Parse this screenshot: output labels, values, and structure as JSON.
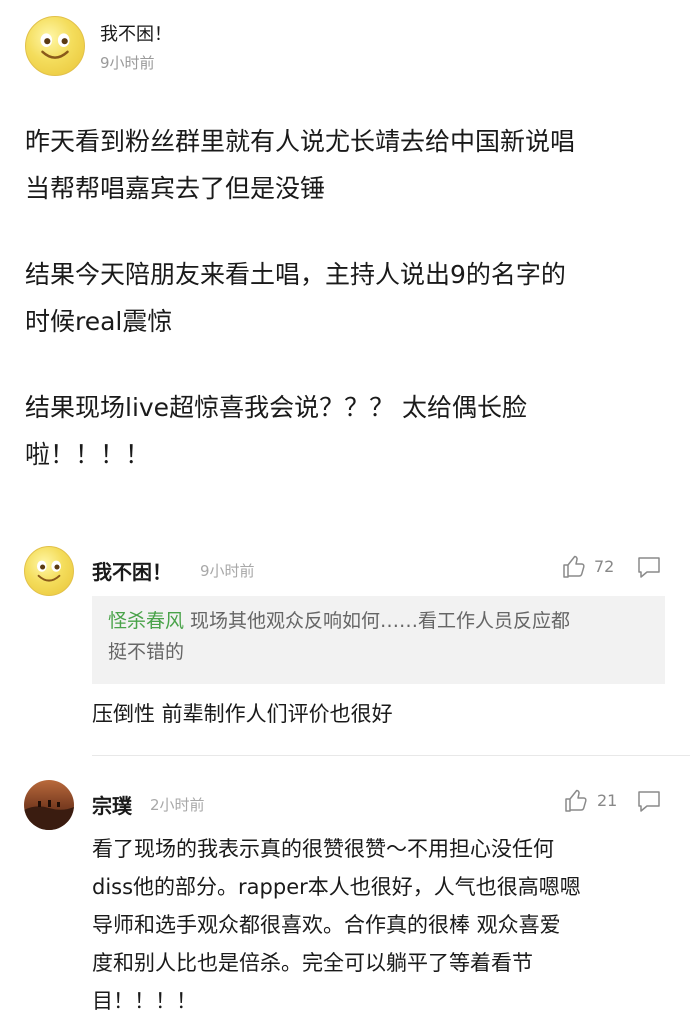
{
  "post": {
    "author": "我不困！",
    "time": "9小时前",
    "paragraphs": [
      [
        "昨天看到粉丝群里就有人说尤长靖去给中国新说唱",
        "当帮帮唱嘉宾去了但是没锤"
      ],
      [
        "结果今天陪朋友来看土唱，主持人说出9的名字的",
        "时候real震惊"
      ],
      [
        "结果现场live超惊喜我会说？？？ 太给偶长脸",
        "啦！！！！"
      ]
    ]
  },
  "comments": [
    {
      "author": "我不困！",
      "time": "9小时前",
      "likes": "72",
      "quote_name": "怪杀春风",
      "quote_text_line1": " 现场其他观众反响如何……看工作人员反应都",
      "quote_text_line2": "挺不错的",
      "text": "压倒性 前辈制作人们评价也很好"
    },
    {
      "author": "宗璞",
      "time": "2小时前",
      "likes": "21",
      "lines": [
        "看了现场的我表示真的很赞很赞～不用担心没任何",
        "diss他的部分。rapper本人也很好，人气也很高嗯嗯",
        "导师和选手观众都很喜欢。合作真的很棒 观众喜爱",
        "度和别人比也是倍杀。完全可以躺平了等着看节",
        "目！！！！"
      ]
    }
  ],
  "icons": {
    "like": "thumbs-up-icon",
    "reply": "comment-bubble-icon",
    "avatar1": "smiley-face-avatar",
    "avatar2": "desert-photo-avatar"
  }
}
